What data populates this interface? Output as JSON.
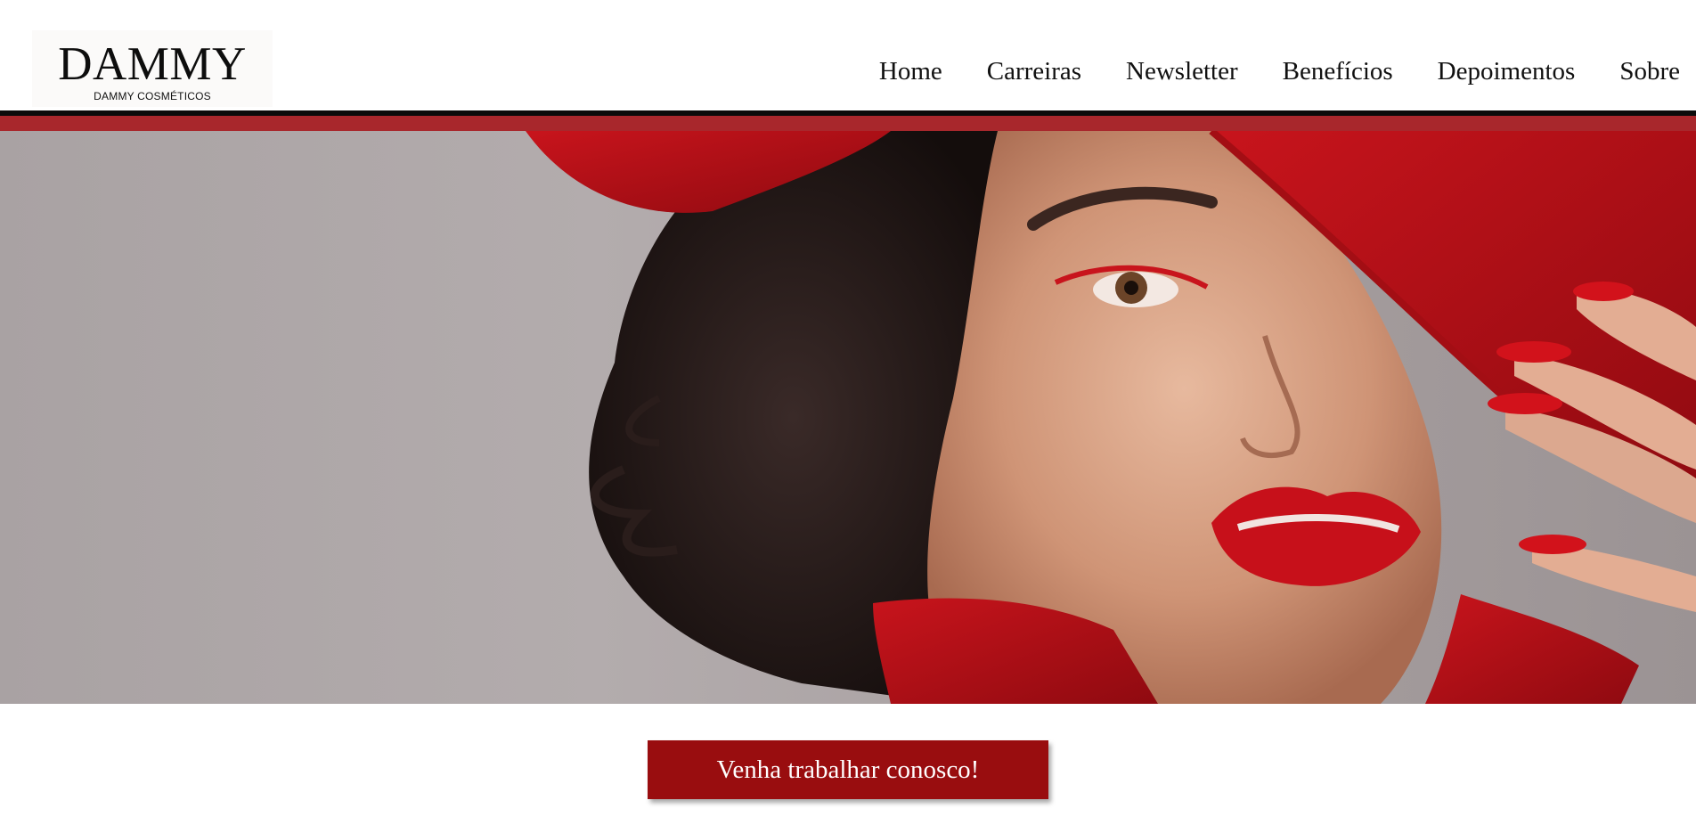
{
  "brand": {
    "name": "DAMMY",
    "tagline": "DAMMY COSMÉTICOS"
  },
  "nav": {
    "items": [
      {
        "label": "Home"
      },
      {
        "label": "Carreiras"
      },
      {
        "label": "Newsletter"
      },
      {
        "label": "Benefícios"
      },
      {
        "label": "Depoimentos"
      },
      {
        "label": "Sobre"
      }
    ]
  },
  "hero": {
    "image_subject": "hero-portrait-photo"
  },
  "cta": {
    "label": "Venha trabalhar conosco!"
  },
  "colors": {
    "accent_red": "#a8272c",
    "button_red": "#990d0f",
    "header_rule": "#0b0b0b"
  }
}
